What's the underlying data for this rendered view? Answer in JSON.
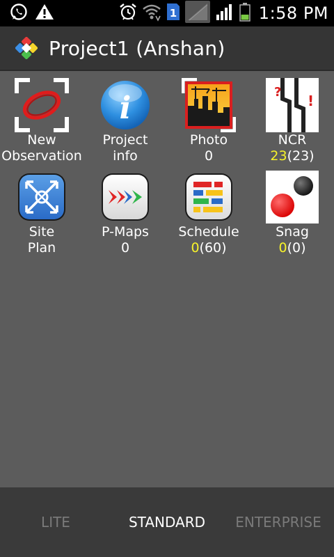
{
  "status_bar": {
    "time": "1:58 PM",
    "sim_badge": "1",
    "icons": [
      "whatsapp-icon",
      "warning-icon",
      "alarm-icon",
      "wifi-icon",
      "sim-icon",
      "no-signal-icon",
      "signal-icon",
      "battery-icon"
    ]
  },
  "action_bar": {
    "title": "Project1 (Anshan)",
    "logo_icon": "app-logo-icon"
  },
  "tiles": [
    {
      "label_line1": "New",
      "label_line2": "Observation",
      "icon": "new-observation-icon"
    },
    {
      "label_line1": "Project",
      "label_line2": "info",
      "icon": "info-icon"
    },
    {
      "label_line1": "Photo",
      "count": "0",
      "icon": "photo-icon"
    },
    {
      "label_line1": "NCR",
      "count_highlight": "23",
      "count_rest": "(23)",
      "icon": "ncr-icon"
    },
    {
      "label_line1": "Site",
      "label_line2": "Plan",
      "icon": "site-plan-icon"
    },
    {
      "label_line1": "P-Maps",
      "count": "0",
      "icon": "pmaps-icon"
    },
    {
      "label_line1": "Schedule",
      "count_highlight": "0",
      "count_rest": "(60)",
      "icon": "schedule-icon"
    },
    {
      "label_line1": "Snag",
      "count_highlight": "0",
      "count_rest": "(0)",
      "icon": "snag-icon"
    }
  ],
  "tabs": {
    "lite": "LITE",
    "standard": "STANDARD",
    "enterprise": "ENTERPRISE",
    "active": "STANDARD"
  },
  "colors": {
    "background": "#5c5c5c",
    "action_bar": "#353535",
    "highlight": "#f7f32a",
    "inactive_tab": "#7a7a7a"
  }
}
